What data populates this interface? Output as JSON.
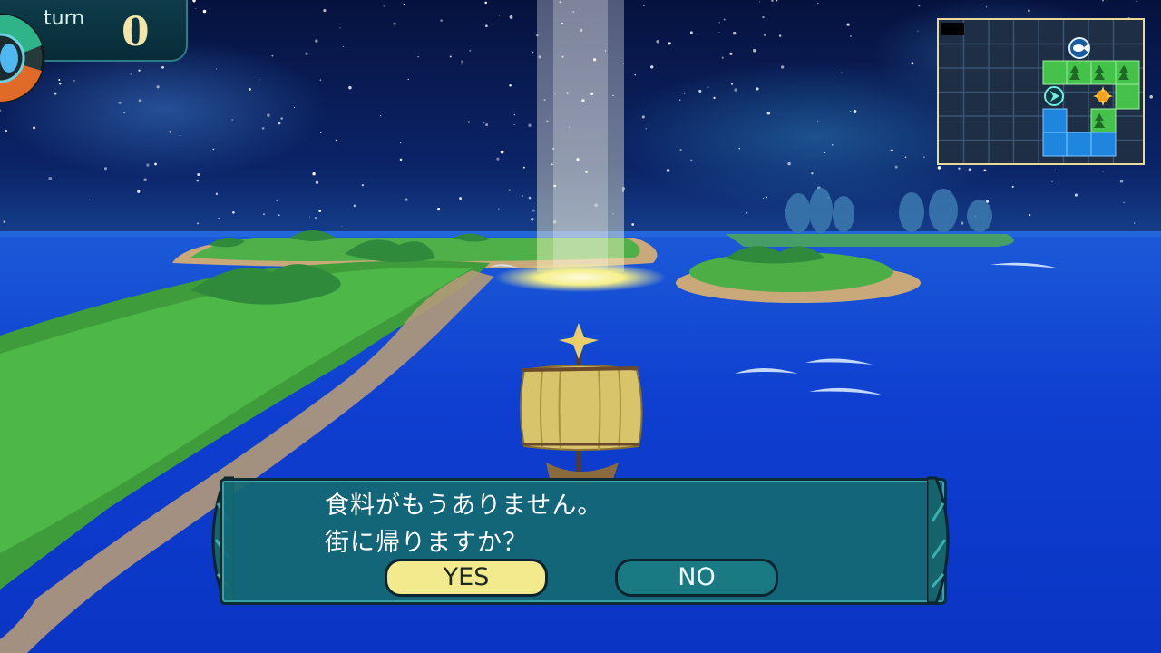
{
  "hud": {
    "turn_label": "turn",
    "turn_value": "0"
  },
  "dialog": {
    "line1": "食料がもうありません。",
    "line2": "街に帰りますか？",
    "yes_label": "YES",
    "no_label": "NO"
  },
  "minimap": {
    "icons": [
      "fish-icon",
      "ship-icon",
      "sun-icon",
      "tree-icon"
    ]
  },
  "colors": {
    "dialog_bg": "#146872",
    "yes_bg": "#f2ea8c",
    "no_bg": "#1a7a83",
    "turn_value": "#f4e6a8",
    "land": "#3ba63b",
    "water": "#1c7fd6"
  }
}
